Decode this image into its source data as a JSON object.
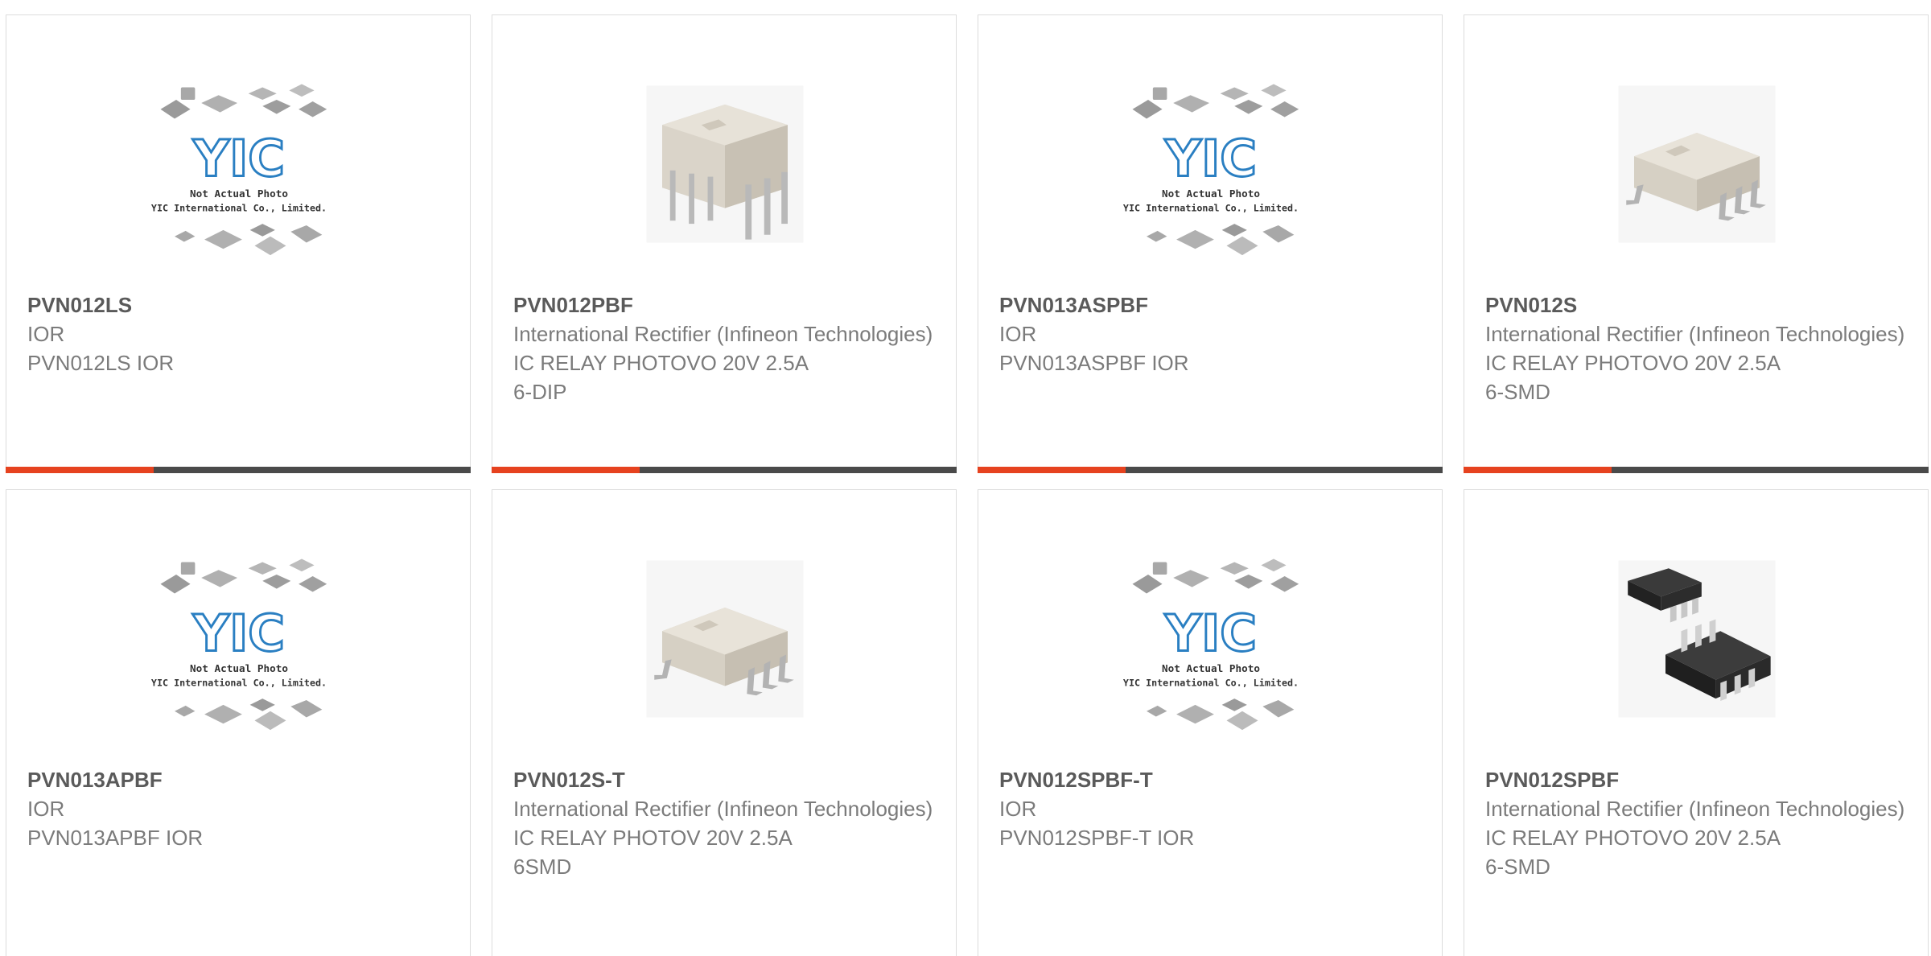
{
  "colors": {
    "accent": "#e6421f",
    "bar": "#4a4a4a",
    "text": "#7b7b7b",
    "title": "#5a5a5a"
  },
  "placeholder": {
    "logo": "YIC",
    "caption1": "Not Actual Photo",
    "caption2": "YIC International Co., Limited."
  },
  "products": [
    {
      "part": "PVN012LS",
      "mfr": "IOR",
      "desc1": "PVN012LS IOR",
      "desc2": "",
      "image": "placeholder"
    },
    {
      "part": "PVN012PBF",
      "mfr": "International Rectifier (Infineon Technologies)",
      "desc1": "IC RELAY PHOTOVO 20V 2.5A",
      "desc2": "6-DIP",
      "image": "dip6-white"
    },
    {
      "part": "PVN013ASPBF",
      "mfr": "IOR",
      "desc1": "PVN013ASPBF IOR",
      "desc2": "",
      "image": "placeholder"
    },
    {
      "part": "PVN012S",
      "mfr": "International Rectifier (Infineon Technologies)",
      "desc1": "IC RELAY PHOTOVO 20V 2.5A",
      "desc2": "6-SMD",
      "image": "smd6-white"
    },
    {
      "part": "PVN013APBF",
      "mfr": "IOR",
      "desc1": "PVN013APBF IOR",
      "desc2": "",
      "image": "placeholder"
    },
    {
      "part": "PVN012S-T",
      "mfr": "International Rectifier (Infineon Technologies)",
      "desc1": "IC RELAY PHOTOV 20V 2.5A",
      "desc2": "6SMD",
      "image": "smd6-white"
    },
    {
      "part": "PVN012SPBF-T",
      "mfr": "IOR",
      "desc1": "PVN012SPBF-T IOR",
      "desc2": "",
      "image": "placeholder"
    },
    {
      "part": "PVN012SPBF",
      "mfr": "International Rectifier (Infineon Technologies)",
      "desc1": "IC RELAY PHOTOVO 20V 2.5A",
      "desc2": "6-SMD",
      "image": "smd6-black"
    }
  ]
}
